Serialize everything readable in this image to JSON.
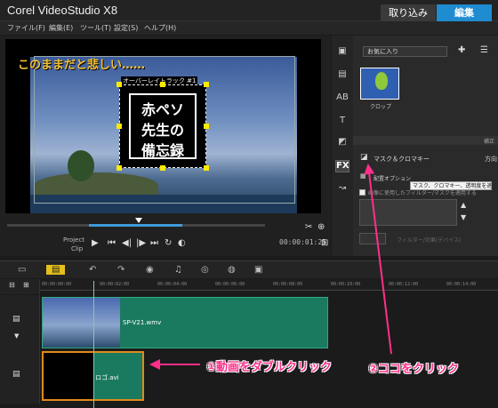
{
  "app": {
    "title": "Corel VideoStudio X8",
    "mode_capture": "取り込み",
    "mode_edit": "編集"
  },
  "menu": [
    "ファイル(F)",
    "編集(E)",
    "ツール(T)",
    "設定(S)",
    "ヘルプ(H)"
  ],
  "preview": {
    "caption": "このままだと悲しい……",
    "overlay_track_label": "オーバーレイトラック #1",
    "logo_lines": [
      "赤ペソ",
      "先生の",
      "備忘録"
    ],
    "project_label": "Project",
    "clip_label": "Clip",
    "timecode": "00:00:01:25"
  },
  "library": {
    "dropdown": "お気に入り",
    "thumb_label": "クロップ",
    "options_title": "補正",
    "mask_chroma": "マスク＆クロマキー",
    "direction": "方向",
    "tooltip": "マスク、クロマキー、透明度を適用",
    "placement": "配置オプション",
    "apply_mask_check": "画像に使用したフィルター/マスクを適用する",
    "link_label": "フィルター/効果(デバイス)"
  },
  "timeline": {
    "ruler_ticks": [
      "00:00:00:00",
      "00:00:02:00",
      "00:00:04:00",
      "00:00:06:00",
      "00:00:08:00",
      "00:00:10:00",
      "00:00:12:00",
      "00:00:14:00"
    ],
    "video_clip": "SP-V21.wmv",
    "overlay_clip": "ロゴ.avi"
  },
  "annotations": {
    "step1": "①動画をダブルクリック",
    "step2": "②ココをクリック",
    "color": "#ff2f8a"
  }
}
